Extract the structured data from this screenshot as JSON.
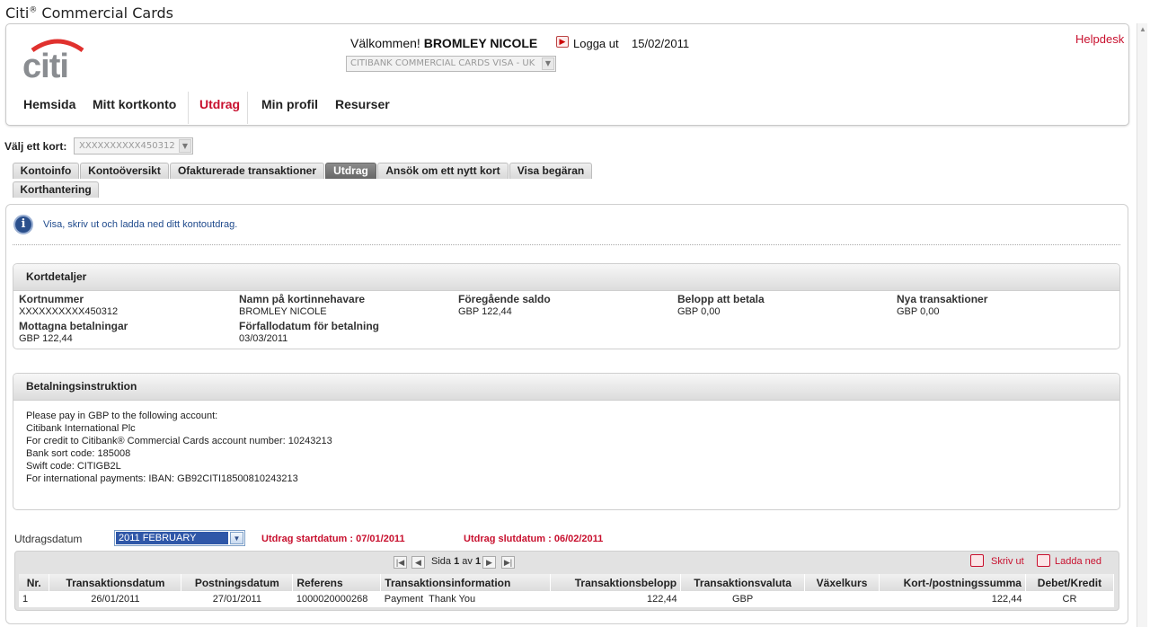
{
  "app": {
    "title": "Citi",
    "title_sup": "®",
    "title_rest": " Commercial Cards"
  },
  "header": {
    "welcome_prefix": "Välkommen!",
    "user_name": "BROMLEY NICOLE",
    "logout_label": "Logga ut",
    "date": "15/02/2011",
    "helpdesk_label": "Helpdesk",
    "card_program": "CITIBANK COMMERCIAL CARDS VISA - UK",
    "logo_text": "citi"
  },
  "nav": {
    "items": [
      "Hemsida",
      "Mitt kortkonto",
      "Utdrag",
      "Min profil",
      "Resurser"
    ],
    "active": "Utdrag"
  },
  "card_select": {
    "label": "Välj ett kort:",
    "value": "XXXXXXXXXX450312"
  },
  "tabs": {
    "items": [
      "Kontoinfo",
      "Kontoöversikt",
      "Ofakturerade transaktioner",
      "Utdrag",
      "Ansök om ett nytt kort",
      "Visa begäran",
      "Korthantering"
    ],
    "active": "Utdrag"
  },
  "info": {
    "text": "Visa, skriv ut och ladda ned ditt kontoutdrag."
  },
  "kortdetaljer": {
    "title": "Kortdetaljer",
    "fields": [
      {
        "label": "Kortnummer",
        "value": "XXXXXXXXXX450312"
      },
      {
        "label": "Namn på kortinnehavare",
        "value": "BROMLEY NICOLE"
      },
      {
        "label": "Föregående saldo",
        "value": "GBP 122,44"
      },
      {
        "label": "Belopp att betala",
        "value": "GBP 0,00"
      },
      {
        "label": "Nya transaktioner",
        "value": "GBP 0,00"
      },
      {
        "label": "Mottagna betalningar",
        "value": "GBP 122,44"
      },
      {
        "label": "Förfallodatum för betalning",
        "value": "03/03/2011"
      }
    ]
  },
  "betalning": {
    "title": "Betalningsinstruktion",
    "lines": [
      "Please pay in GBP to the following account:",
      "Citibank International Plc",
      "For credit to Citibank® Commercial Cards account number: 10243213",
      "Bank sort code: 185008",
      "Swift code: CITIGB2L",
      "For international payments: IBAN: GB92CITI18500810243213"
    ]
  },
  "statement": {
    "date_label": "Utdragsdatum",
    "selected": "2011 FEBRUARY",
    "start": "Utdrag startdatum : 07/01/2011",
    "end": "Utdrag slutdatum : 06/02/2011"
  },
  "pager": {
    "page_prefix": "Sida",
    "page": "1",
    "of": "av",
    "total": "1"
  },
  "tools": {
    "print": "Skriv ut",
    "download": "Ladda ned"
  },
  "table": {
    "columns": [
      "Nr.",
      "Transaktionsdatum",
      "Postningsdatum",
      "Referens",
      "Transaktionsinformation",
      "Transaktionsbelopp",
      "Transaktionsvaluta",
      "Växelkurs",
      "Kort-/postningssumma",
      "Debet/Kredit"
    ],
    "rows": [
      [
        "1",
        "26/01/2011",
        "27/01/2011",
        "1000020000268",
        "Payment  Thank You",
        "122,44",
        "GBP",
        "",
        "122,44",
        "CR"
      ]
    ]
  },
  "colors": {
    "brand_red": "#c8102e",
    "brand_blue": "#1f4a8c"
  }
}
